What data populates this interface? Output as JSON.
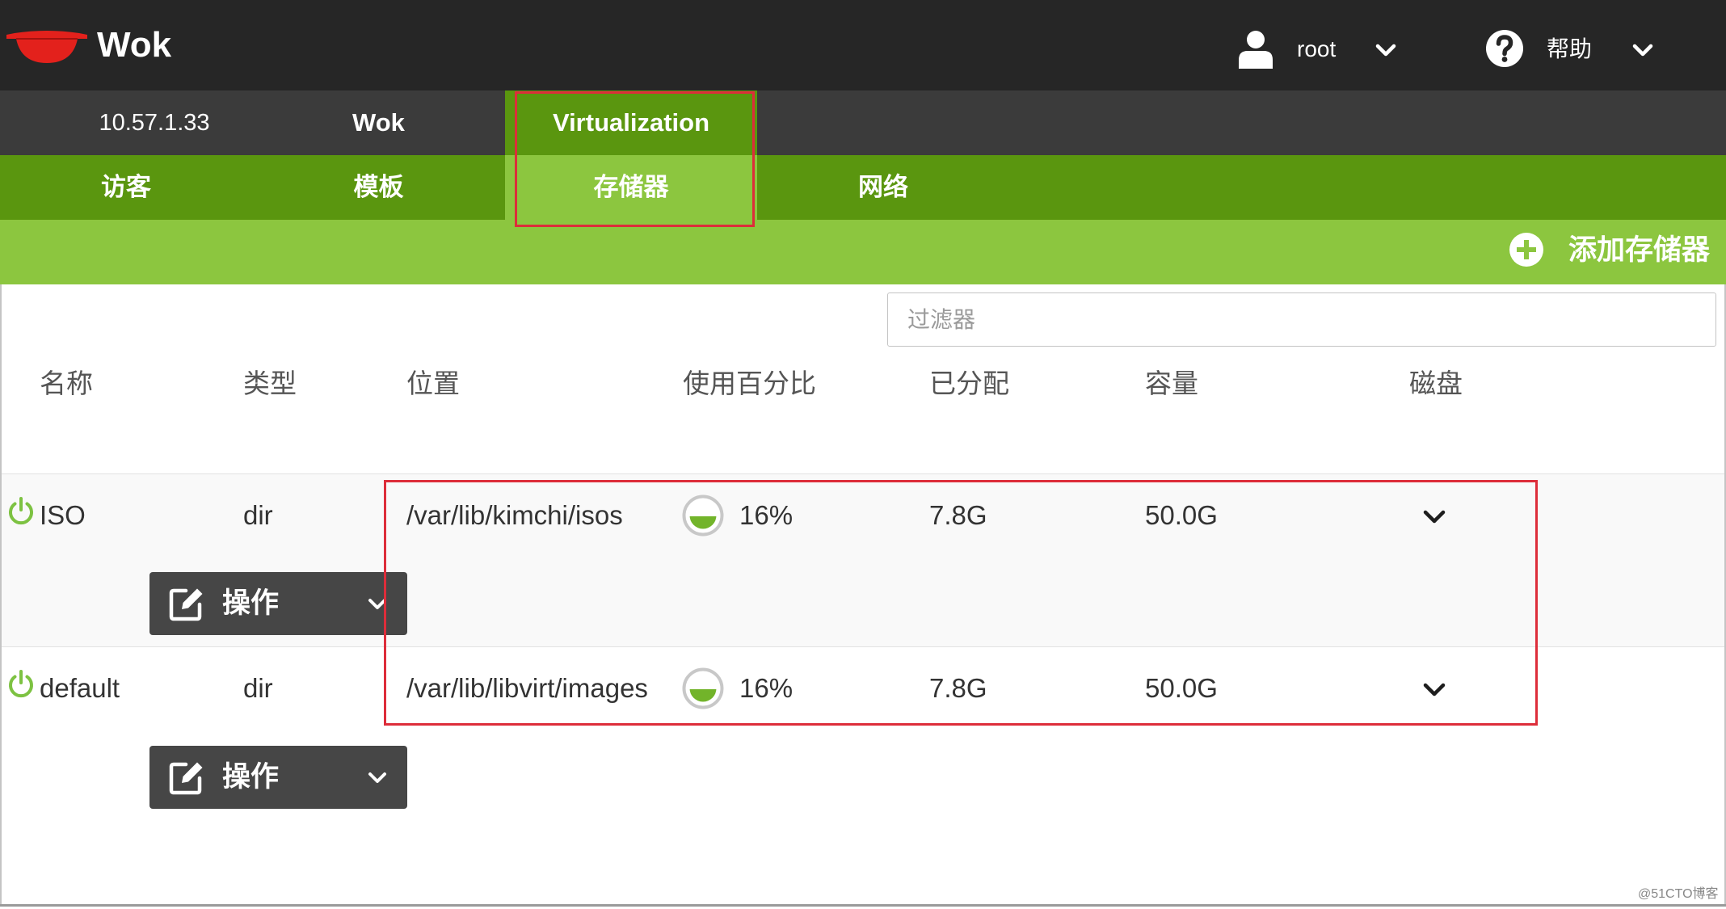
{
  "colors": {
    "header_bg": "#262626",
    "nav_primary_bg": "#3b3b3b",
    "nav_secondary_bg": "#5a960f",
    "active_light": "#8cc63f",
    "highlight": "#dd2d3a",
    "action_button_bg": "#464646",
    "power_green": "#7dc242",
    "usage_fill": "#72b42a"
  },
  "header": {
    "logo_icon": "wok-logo-icon",
    "app_name": "Wok",
    "user_icon": "user-icon",
    "user_name": "root",
    "user_menu_icon": "chevron-down-icon",
    "help_icon": "help-icon",
    "help_label": "帮助",
    "help_menu_icon": "chevron-down-icon"
  },
  "nav_primary": {
    "host": "10.57.1.33",
    "tabs": [
      {
        "label": "Wok",
        "active": false
      },
      {
        "label": "Virtualization",
        "active": true
      }
    ]
  },
  "nav_secondary": {
    "tabs": [
      {
        "label": "访客",
        "active": false
      },
      {
        "label": "模板",
        "active": false
      },
      {
        "label": "存储器",
        "active": true
      },
      {
        "label": "网络",
        "active": false
      }
    ]
  },
  "toolbar": {
    "add_icon": "plus-circle-icon",
    "add_storage_label": "添加存储器"
  },
  "filter": {
    "placeholder": "过滤器",
    "value": ""
  },
  "table": {
    "columns": [
      "名称",
      "类型",
      "位置",
      "使用百分比",
      "已分配",
      "容量",
      "磁盘"
    ],
    "rows": [
      {
        "state_icon": "power-icon",
        "name": "ISO",
        "type": "dir",
        "location": "/var/lib/kimchi/isos",
        "usage_icon": "usage-gauge-icon",
        "usage": "16%",
        "allocated": "7.8G",
        "capacity": "50.0G",
        "disk_toggle_icon": "chevron-down-icon",
        "action_icon": "edit-icon",
        "action_label": "操作",
        "action_menu_icon": "chevron-down-icon"
      },
      {
        "state_icon": "power-icon",
        "name": "default",
        "type": "dir",
        "location": "/var/lib/libvirt/images",
        "usage_icon": "usage-gauge-icon",
        "usage": "16%",
        "allocated": "7.8G",
        "capacity": "50.0G",
        "disk_toggle_icon": "chevron-down-icon",
        "action_icon": "edit-icon",
        "action_label": "操作",
        "action_menu_icon": "chevron-down-icon"
      }
    ]
  },
  "watermark": "@51CTO博客"
}
